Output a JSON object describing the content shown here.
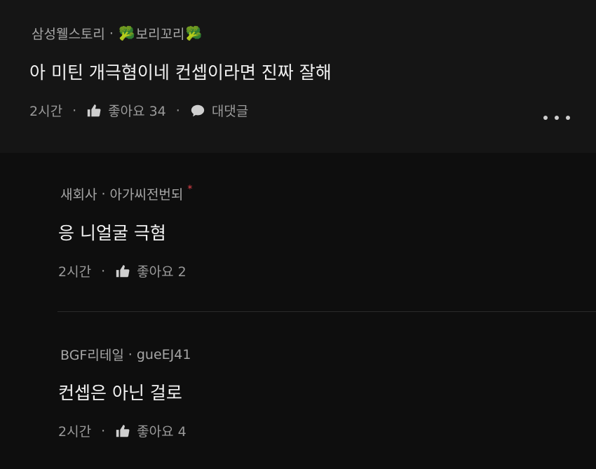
{
  "main_comment": {
    "company": "삼성웰스토리",
    "nickname": "보리꼬리",
    "nickname_emoji": "🥦",
    "text": "아 미틴 개극혐이네 컨셉이라면 진짜 잘해",
    "time": "2시간",
    "like_label": "좋아요 34",
    "reply_label": "대댓글",
    "more_icon": "more-horizontal-icon"
  },
  "replies": [
    {
      "company": "새회사",
      "nickname": "아가씨전번되",
      "badge": "*",
      "text": "응 니얼굴 극혐",
      "time": "2시간",
      "like_label": "좋아요 2"
    },
    {
      "company": "BGF리테일",
      "nickname": "gueEJ41",
      "text": "컨셉은 아닌 걸로",
      "time": "2시간",
      "like_label": "좋아요 4"
    }
  ],
  "separator": "·",
  "colors": {
    "background": "#0f0f0f",
    "main_comment_bg": "#151515",
    "meta_text": "#a6a6a6",
    "body_text": "#f2f2f2",
    "badge_red": "#e8434c"
  }
}
